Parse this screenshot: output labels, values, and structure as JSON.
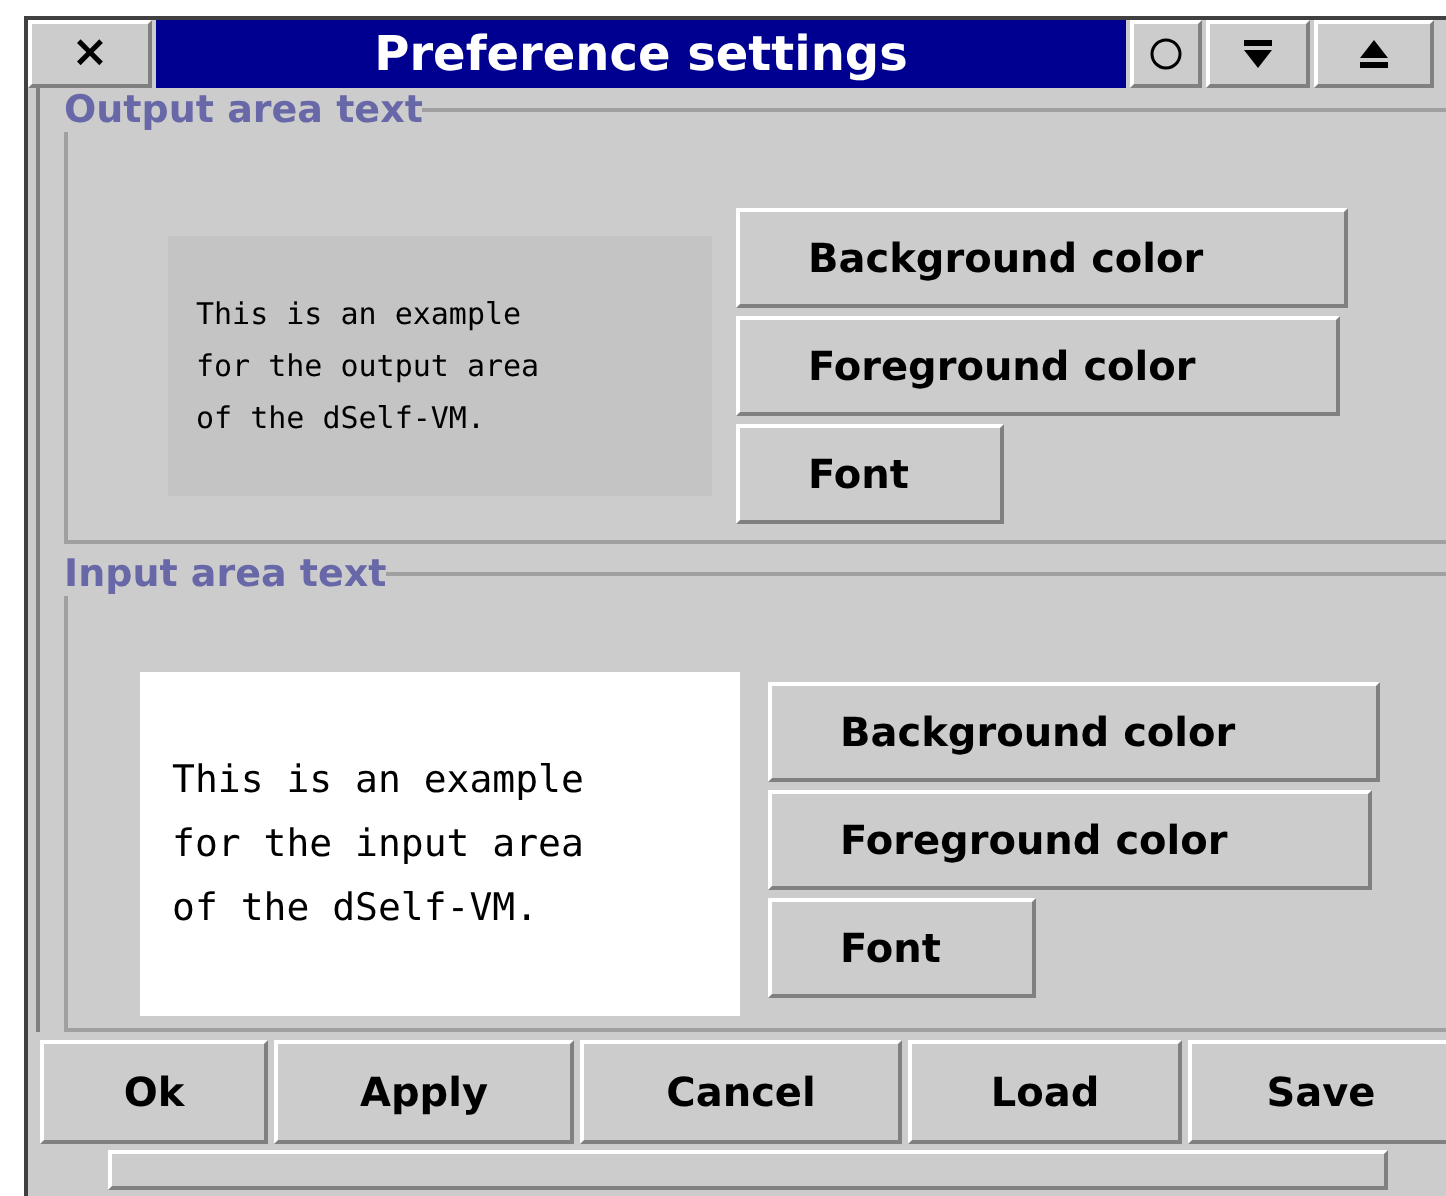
{
  "window": {
    "title": "Preference settings",
    "close": "×"
  },
  "groups": [
    {
      "kind": "output",
      "legend": "Output area text",
      "sample": [
        "This is an example",
        "for the output area",
        "of the dSelf-VM."
      ],
      "buttons": [
        "Background color",
        "Foreground color",
        "Font"
      ]
    },
    {
      "kind": "input",
      "legend": "Input area text",
      "sample": [
        "This is an example",
        "for the input area",
        "of the dSelf-VM."
      ],
      "buttons": [
        "Background color",
        "Foreground color",
        "Font"
      ]
    }
  ],
  "buttons": [
    "Ok",
    "Apply",
    "Cancel",
    "Load",
    "Save"
  ]
}
